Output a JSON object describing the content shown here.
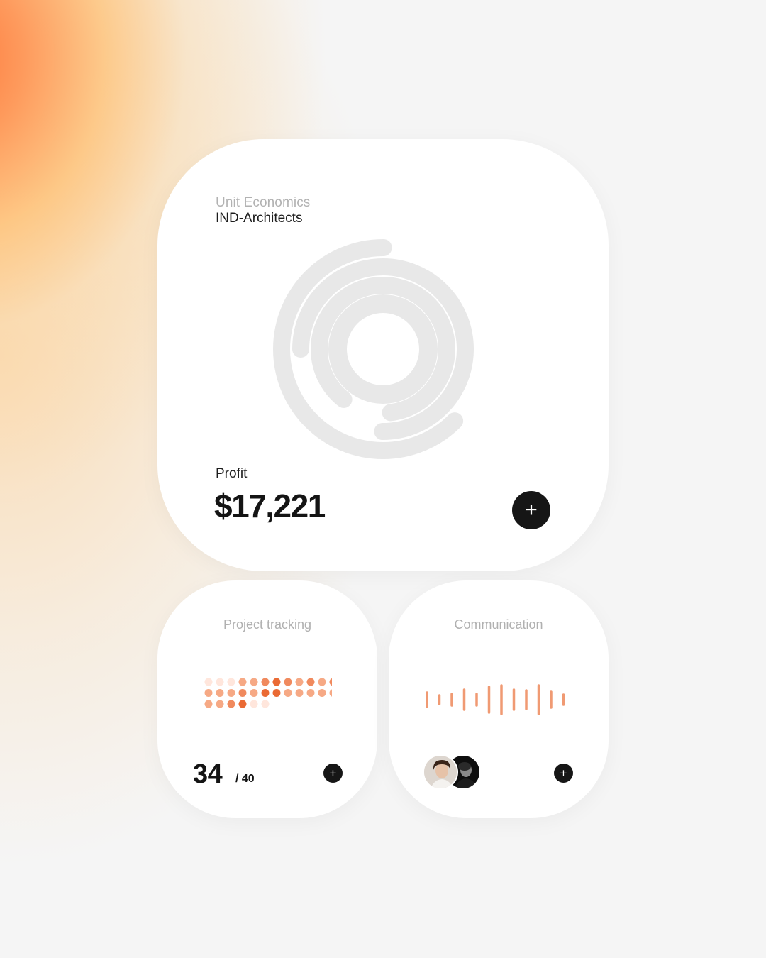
{
  "main_card": {
    "eyebrow": "Unit Economics",
    "client": "IND-Architects",
    "metric_label": "Profit",
    "metric_value": "$17,221",
    "add_symbol": "+",
    "ring_chart": {
      "track_color": "#e8e8e8",
      "rings": [
        {
          "name": "outer",
          "fill": 0.625
        },
        {
          "name": "ring-2",
          "fill": 0.75
        },
        {
          "name": "ring-3",
          "fill": 0.875
        },
        {
          "name": "inner",
          "fill": 1.0
        }
      ]
    }
  },
  "project_card": {
    "title": "Project tracking",
    "count": "34",
    "total": "/ 40",
    "add_symbol": "+",
    "accent_color": "#ea6a34"
  },
  "communication_card": {
    "title": "Communication",
    "add_symbol": "+",
    "wave_color": "#f09a73",
    "participants": [
      "avatar-person-light-shirt",
      "avatar-person-dark"
    ]
  }
}
